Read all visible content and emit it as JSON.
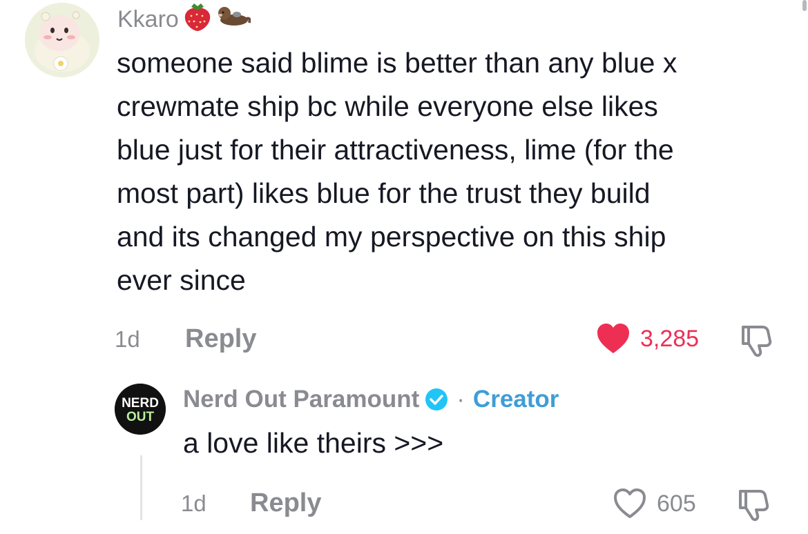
{
  "colors": {
    "muted": "#8a8b91",
    "text": "#161823",
    "like_active": "#ee2f54",
    "creator_accent": "#3f9dd6",
    "verified_badge": "#20c5f6"
  },
  "comment": {
    "username": "Kkaro",
    "username_emojis": [
      "🍓",
      "🦦"
    ],
    "avatar_icon": "chiikawa-avatar-icon",
    "text": "someone said blime is better than any blue x crewmate ship bc while everyone else likes blue just for their attractiveness, lime (for the most part) likes blue for the trust they build and its changed my perspective on this ship ever since",
    "text_lines": [
      "someone said blime is better than any blue x",
      "crewmate ship bc while everyone else likes",
      "blue just for their attractiveness, lime (for the",
      "most part) likes blue for the trust they build",
      "and its changed my perspective on this ship",
      "ever since"
    ],
    "time": "1d",
    "reply_label": "Reply",
    "likes": "3,285",
    "liked": true
  },
  "reply": {
    "avatar_text_top": "NERD",
    "avatar_text_bottom": "OUT",
    "username": "Nerd Out Paramount",
    "separator": "·",
    "tag": "Creator",
    "text": "a love like theirs >>>",
    "time": "1d",
    "reply_label": "Reply",
    "likes": "605",
    "liked": false
  }
}
